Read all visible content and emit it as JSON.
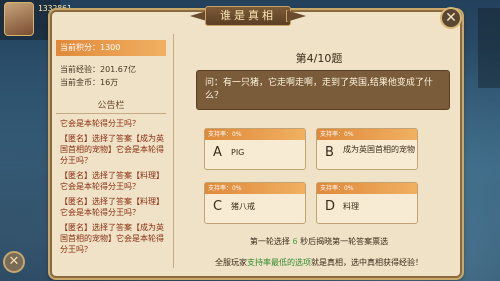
{
  "header": {
    "title": "谁是真相",
    "close_icon": "close-icon"
  },
  "player": {
    "id_text": "1332861",
    "score": "当前积分：1300",
    "exp": "当前经验：201.67亿",
    "gold": "当前金币：16万"
  },
  "bulletin": {
    "title": "公告栏",
    "items": [
      "它会是本轮得分王吗？",
      "【匿名】选择了答案【成为英国首相的宠物】它会是本轮得分王吗？",
      "【匿名】选择了答案【料理】它会是本轮得分王吗？",
      "【匿名】选择了答案【料理】它会是本轮得分王吗？",
      "【匿名】选择了答案【成为英国首相的宠物】它会是本轮得分王吗？"
    ]
  },
  "question": {
    "number": "第4/10题",
    "text": "问：有一只猪，它走啊走啊，走到了英国,结果他变成了什么？"
  },
  "options": [
    {
      "rate": "支持率：0%",
      "letter": "A",
      "text": "PIG"
    },
    {
      "rate": "支持率：0%",
      "letter": "B",
      "text": "成为英国首相的宠物"
    },
    {
      "rate": "支持率：0%",
      "letter": "C",
      "text": "猪八戒"
    },
    {
      "rate": "支持率：0%",
      "letter": "D",
      "text": "料理"
    }
  ],
  "countdown": {
    "before": "第一轮选择",
    "seconds": "6",
    "after": "秒后揭晓第一轮答案票选"
  },
  "footer": {
    "before": "全服玩家",
    "highlight": "支持率最低的选项",
    "after": "就是真相，选中真相获得经验！"
  },
  "colors": {
    "accent": "#e0893a",
    "panel": "#efe2c6",
    "question_bg": "#7a5b3a",
    "highlight_green": "#2e8a2e"
  }
}
